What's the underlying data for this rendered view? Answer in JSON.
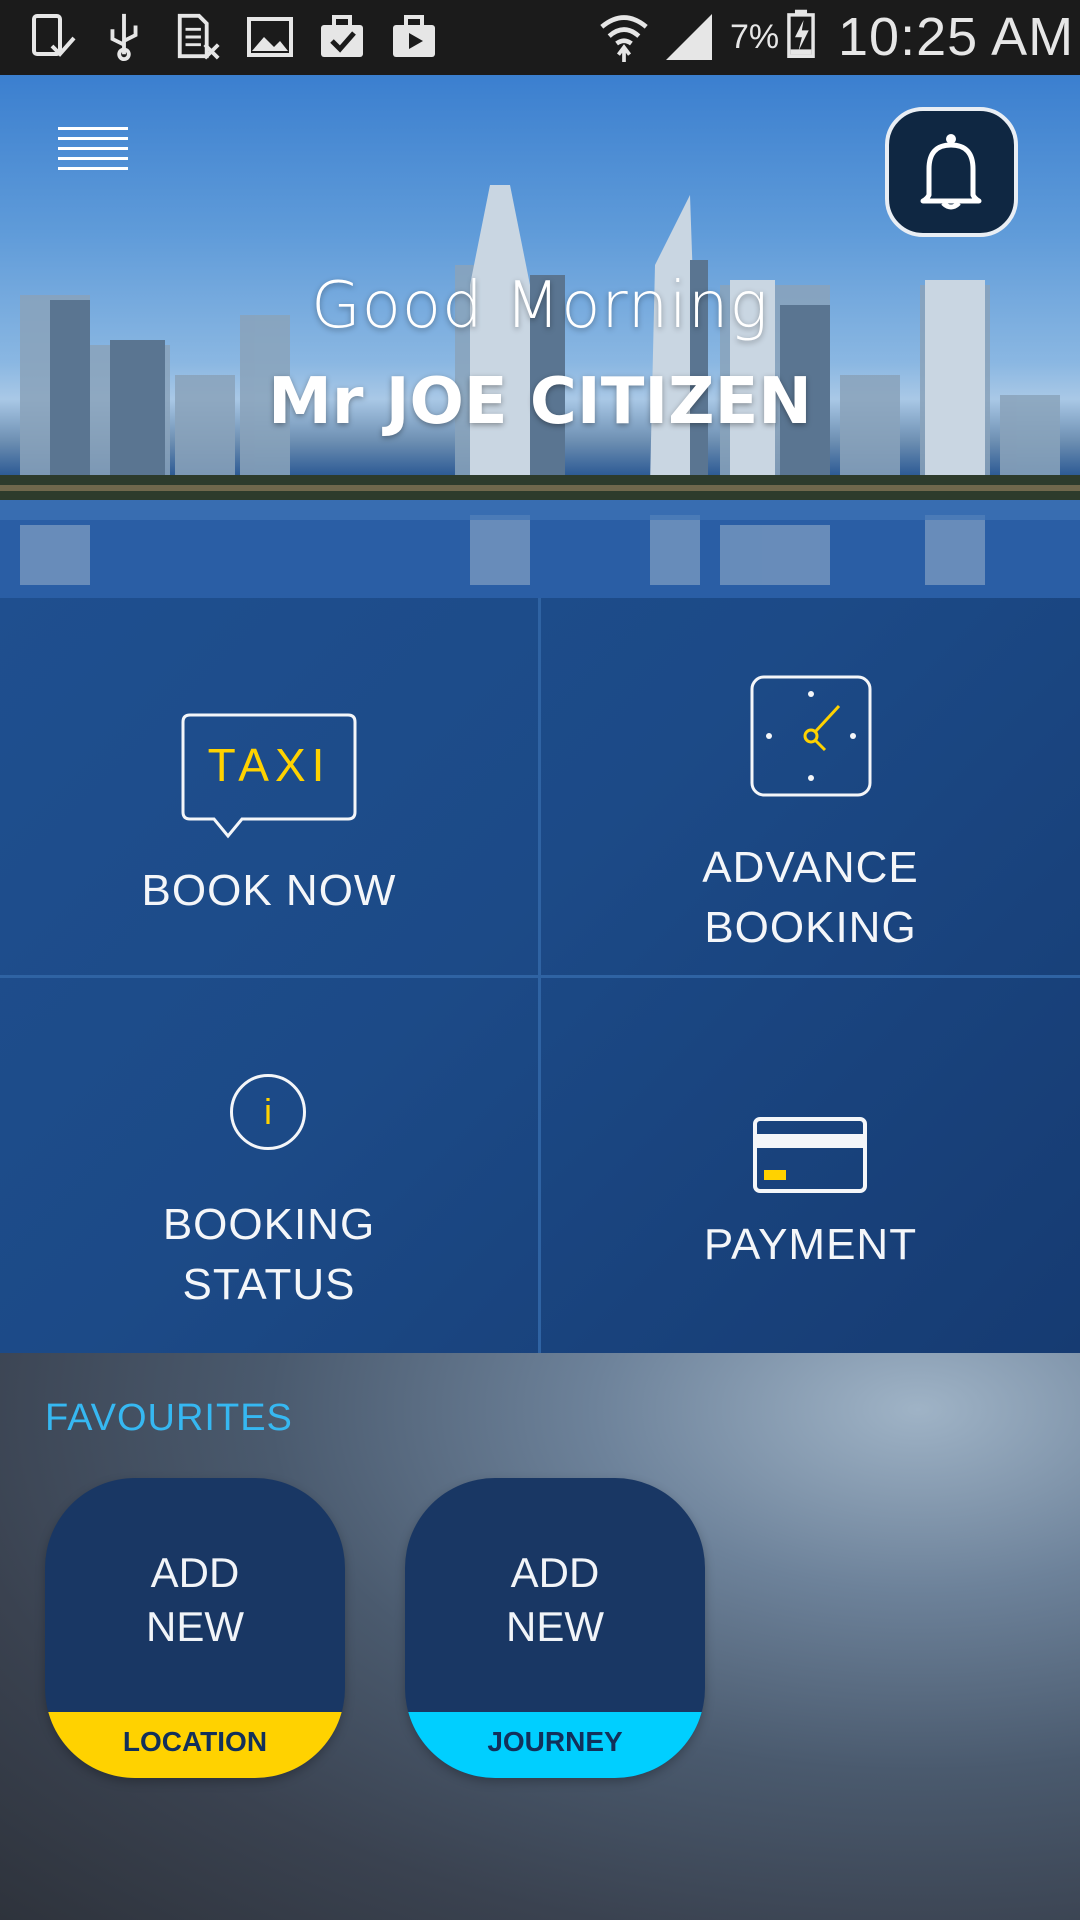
{
  "status_bar": {
    "battery_percent": "7%",
    "time": "10:25 AM",
    "icons": [
      "tablet-check-icon",
      "usb-icon",
      "sim-card-x-icon",
      "image-icon",
      "briefcase-check-icon",
      "briefcase-play-icon",
      "wifi-icon",
      "signal-icon",
      "battery-charging-icon"
    ]
  },
  "header": {
    "greeting": "Good Morning",
    "user_name": "Mr JOE CITIZEN",
    "menu_icon": "hamburger-menu-icon",
    "notification_icon": "bell-icon"
  },
  "actions": {
    "book_now": {
      "icon_text": "TAXI",
      "label": "BOOK NOW"
    },
    "advance_booking": {
      "label_line1": "ADVANCE",
      "label_line2": "BOOKING"
    },
    "booking_status": {
      "icon_text": "i",
      "label_line1": "BOOKING",
      "label_line2": "STATUS"
    },
    "payment": {
      "label": "PAYMENT"
    }
  },
  "favourites": {
    "title": "FAVOURITES",
    "cards": [
      {
        "line1": "ADD",
        "line2": "NEW",
        "tag": "LOCATION",
        "tag_color": "#ffd200"
      },
      {
        "line1": "ADD",
        "line2": "NEW",
        "tag": "JOURNEY",
        "tag_color": "#00cfff"
      }
    ]
  },
  "colors": {
    "accent_yellow": "#ffd200",
    "accent_cyan": "#00cfff",
    "tile_blue": "#1c4a87",
    "favourites_title": "#36b8f2"
  }
}
